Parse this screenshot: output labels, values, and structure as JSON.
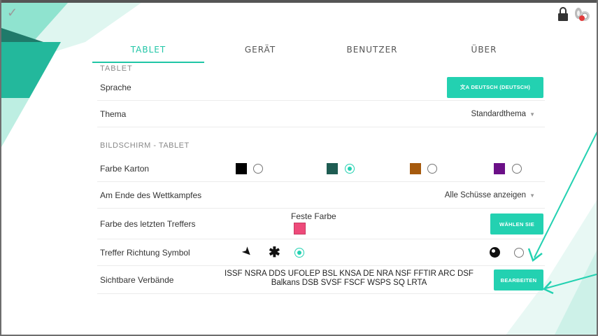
{
  "tabs": [
    {
      "label": "TABLET",
      "active": true
    },
    {
      "label": "GERÄT",
      "active": false
    },
    {
      "label": "BENUTZER",
      "active": false
    },
    {
      "label": "ÜBER",
      "active": false
    }
  ],
  "section_tablet": {
    "header": "TABLET"
  },
  "language": {
    "label": "Sprache",
    "button": "文A DEUTSCH (DEUTSCH)"
  },
  "theme": {
    "label": "Thema",
    "value": "Standardthema"
  },
  "section_screen": {
    "header": "BILDSCHIRM - TABLET"
  },
  "card_color": {
    "label": "Farbe Karton",
    "options": [
      {
        "color": "#000000",
        "selected": false
      },
      {
        "color": "#1e5c52",
        "selected": true
      },
      {
        "color": "#a65a0e",
        "selected": false
      },
      {
        "color": "#6b0f87",
        "selected": false
      }
    ]
  },
  "end_of_competition": {
    "label": "Am Ende des Wettkampfes",
    "value": "Alle Schüsse anzeigen"
  },
  "last_hit_color": {
    "label": "Farbe des letzten Treffers",
    "mode": "Feste Farbe",
    "color": "#ee4a7a",
    "button": "WÄHLEN SIE"
  },
  "hit_direction": {
    "label": "Treffer Richtung Symbol"
  },
  "federations": {
    "label": "Sichtbare Verbände",
    "line1": "ISSF NSRA DDS UFOLEP BSL KNSA DE NRA NSF FFTIR ARC DSF",
    "line2": "Balkans DSB SVSF FSCF WSPS SQ LRTA",
    "button": "BEARBEITEN"
  },
  "colors": {
    "accent": "#23d1b1",
    "tab_active": "#20c5a6"
  },
  "icons": [
    "check-icon",
    "lock-icon",
    "alert-icon",
    "arrow-symbol-icon",
    "asterisk-symbol-icon",
    "dot-symbol-icon"
  ]
}
